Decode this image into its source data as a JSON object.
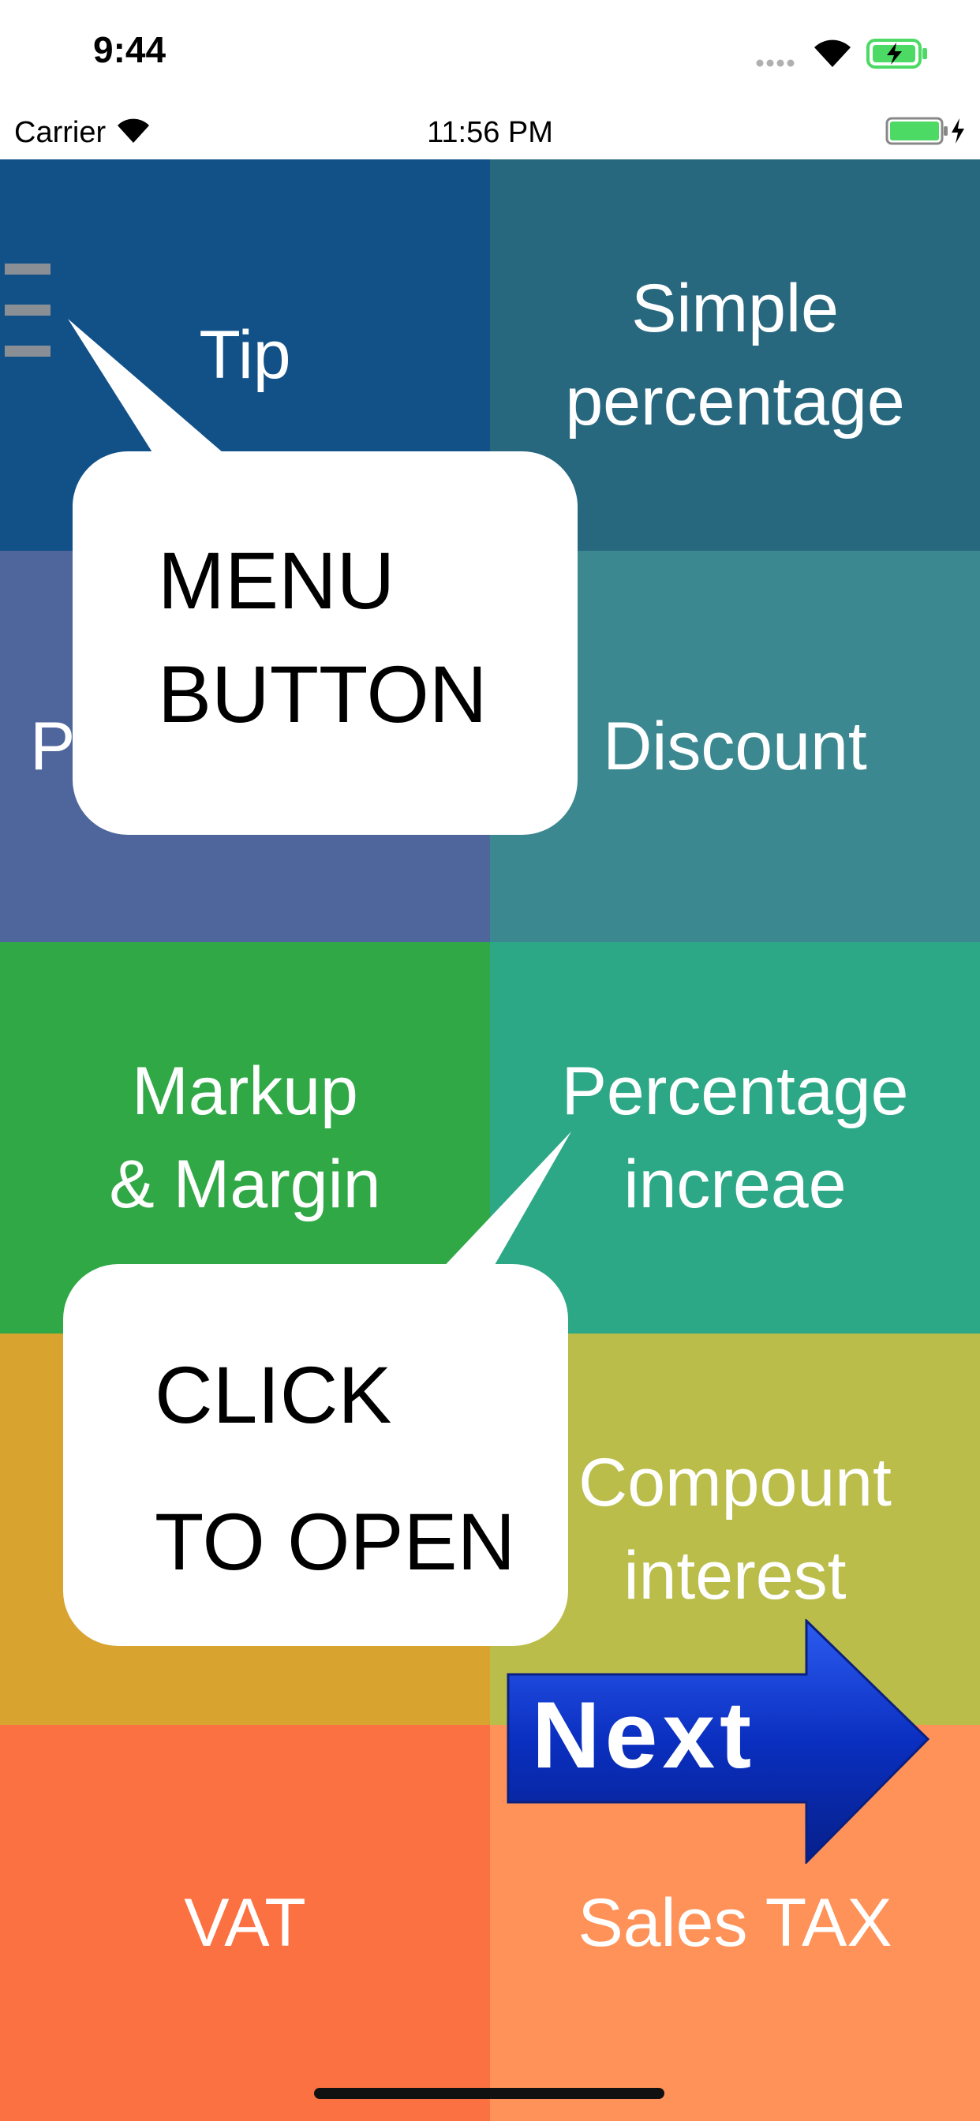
{
  "status_bar": {
    "time": "9:44"
  },
  "carrier_bar": {
    "carrier": "Carrier",
    "time": "11:56 PM"
  },
  "tiles": [
    {
      "line1": "Tip",
      "line2": "",
      "color": "#125187"
    },
    {
      "line1": "Simple",
      "line2": "percentage",
      "color": "#27687F"
    },
    {
      "line1": "P",
      "line2": "",
      "color": "#4E669B"
    },
    {
      "line1": "Discount",
      "line2": "",
      "color": "#3C8891"
    },
    {
      "line1": "Markup",
      "line2": "& Margin",
      "color": "#30A846"
    },
    {
      "line1": "Percentage",
      "line2": "increae",
      "color": "#2CA887"
    },
    {
      "line1": "",
      "line2": "",
      "color": "#D8A32E"
    },
    {
      "line1": "Compount",
      "line2": "interest",
      "color": "#BABD4A"
    },
    {
      "line1": "VAT",
      "line2": "",
      "color": "#FC7142"
    },
    {
      "line1": "Sales TAX",
      "line2": "",
      "color": "#FE9258"
    }
  ],
  "callouts": {
    "menu": {
      "line1": "MENU",
      "line2": "BUTTON"
    },
    "open": {
      "line1": "CLICK",
      "line2": "TO OPEN"
    }
  },
  "next_button": {
    "label": "Next",
    "color": "#0A2FC0"
  }
}
